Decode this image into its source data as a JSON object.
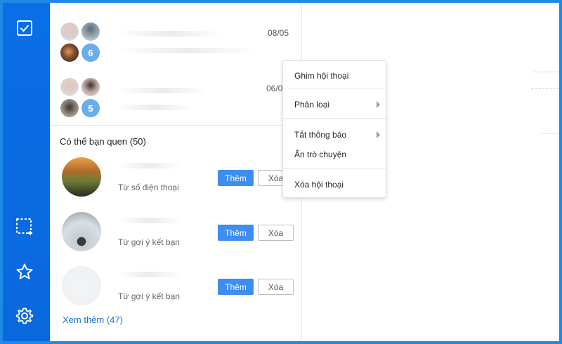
{
  "rail": {
    "icons": [
      "checkbox-icon",
      "screenshot-icon",
      "star-icon",
      "gear-icon"
    ]
  },
  "conversations": [
    {
      "date": "08/05",
      "member_count": "6"
    },
    {
      "date": "06/0",
      "member_count": "5"
    }
  ],
  "suggestions": {
    "title": "Có thể bạn quen (50)",
    "items": [
      {
        "source": "Từ số điện thoại",
        "add_label": "Thêm",
        "remove_label": "Xóa"
      },
      {
        "source": "Từ gợi ý kết bạn",
        "add_label": "Thêm",
        "remove_label": "Xóa"
      },
      {
        "source": "Từ gợi ý kết bạn",
        "add_label": "Thêm",
        "remove_label": "Xóa"
      }
    ],
    "more_label": "Xem thêm (47)"
  },
  "context_menu": {
    "items": [
      {
        "label": "Ghim hội thoại",
        "submenu": false
      },
      {
        "label": "Phân loại",
        "submenu": true
      },
      {
        "label": "Tắt thông báo",
        "submenu": true
      },
      {
        "label": "Ẩn trò chuyện",
        "submenu": false
      },
      {
        "label": "Xóa hội thoại",
        "submenu": false
      }
    ]
  },
  "colors": {
    "rail": "#0a6ee6",
    "accent": "#3e8df0",
    "link": "#1a73d9",
    "badge": "#69aee8"
  }
}
